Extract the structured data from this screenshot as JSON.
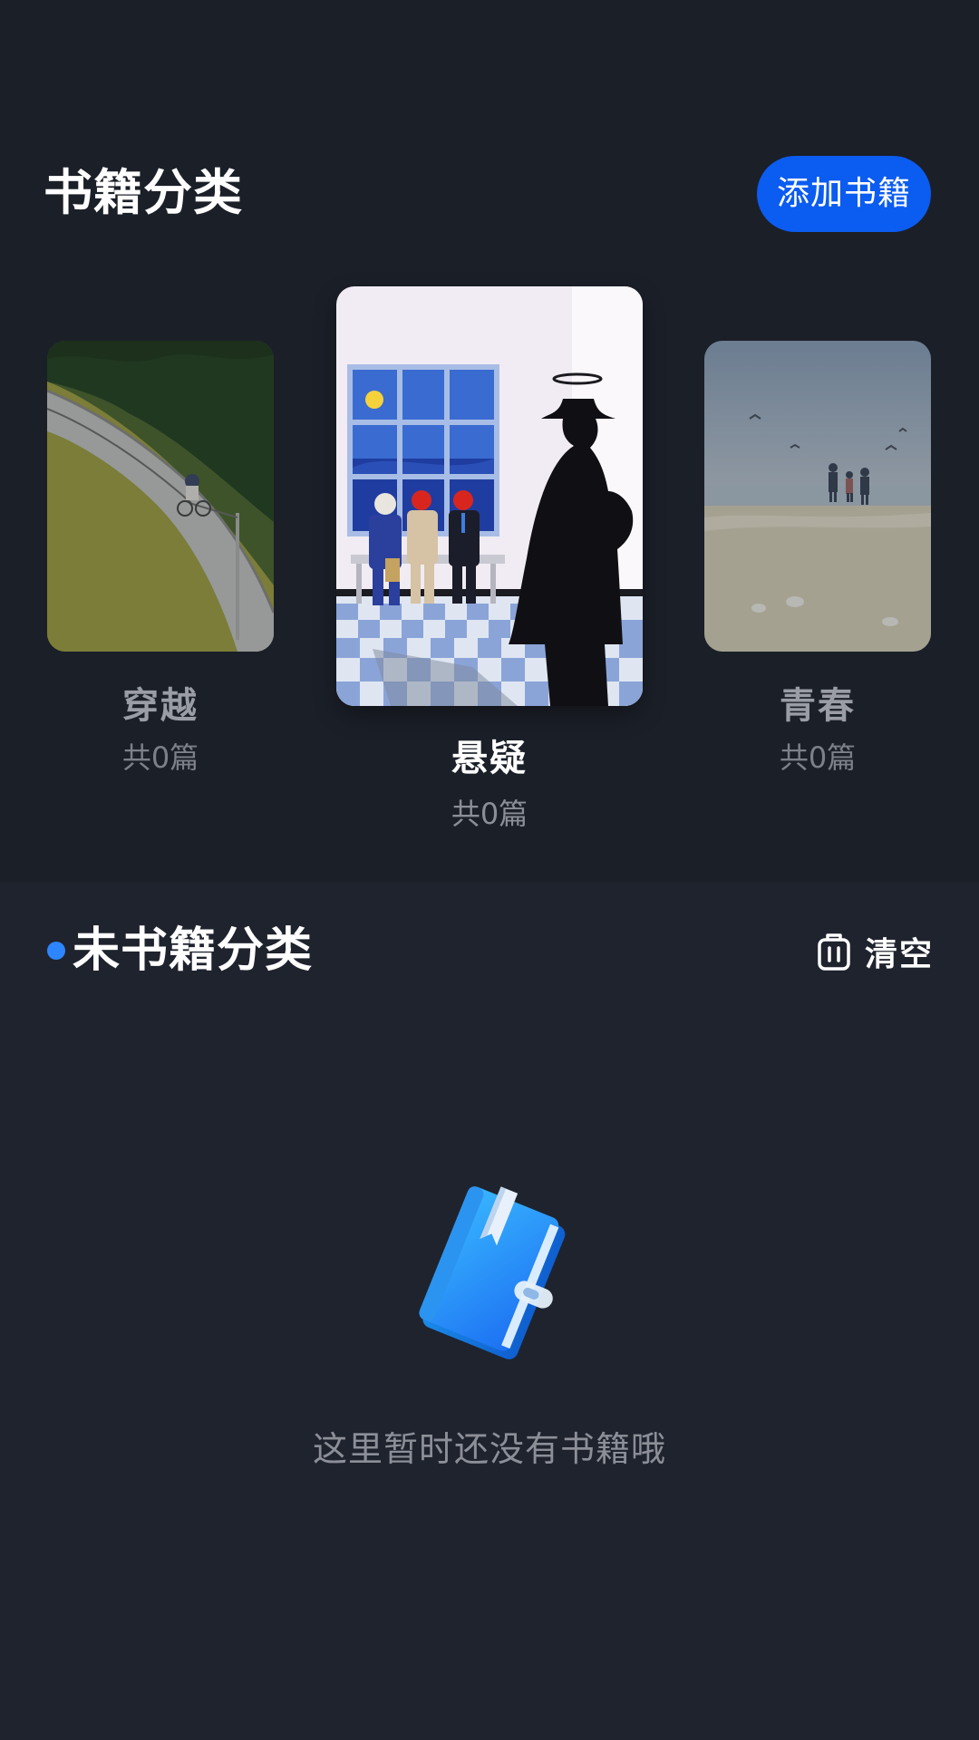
{
  "header": {
    "title": "书籍分类",
    "add_button_label": "添加书籍"
  },
  "categories": [
    {
      "name": "穿越",
      "count": "共0篇"
    },
    {
      "name": "悬疑",
      "count": "共0篇"
    },
    {
      "name": "青春",
      "count": "共0篇"
    }
  ],
  "uncategorized": {
    "title": "未书籍分类",
    "clear_label": "清空",
    "empty_text": "这里暂时还没有书籍哦"
  },
  "colors": {
    "accent": "#0b5cf0",
    "dot": "#2d86ff",
    "background_top": "#1b1f28",
    "background_bottom": "#1f232e"
  },
  "icons": {
    "clear": "trash-icon",
    "empty": "book-illustration"
  }
}
